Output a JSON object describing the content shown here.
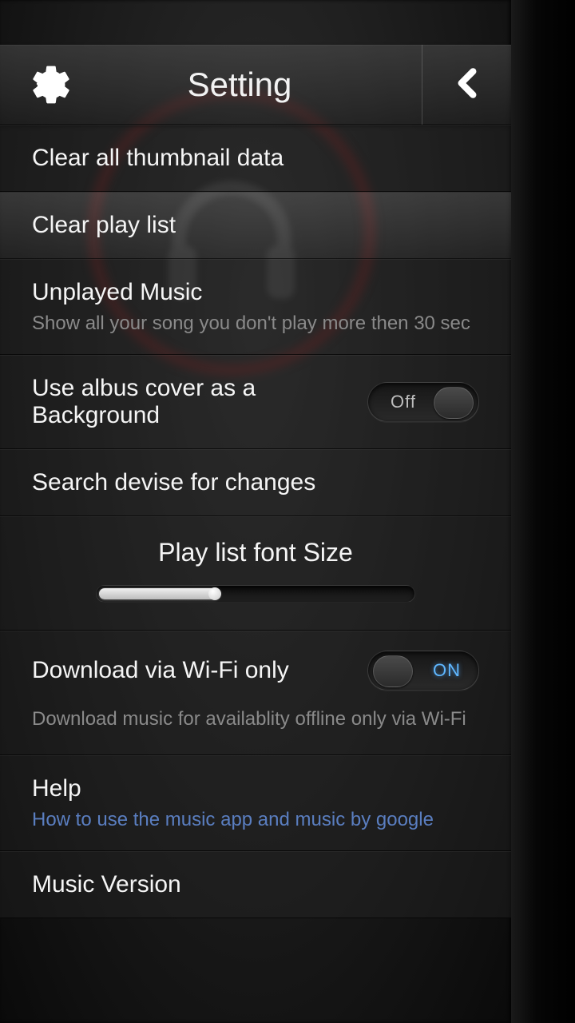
{
  "header": {
    "title": "Setting"
  },
  "rows": {
    "clear_thumb": {
      "label": "Clear all thumbnail data"
    },
    "clear_playlist": {
      "label": "Clear play list"
    },
    "unplayed": {
      "label": "Unplayed Music",
      "sub": "Show all your song you don't play more then 30 sec"
    },
    "album_bg": {
      "label": "Use albus cover as a Background",
      "toggle_state": "Off"
    },
    "search_device": {
      "label": "Search devise for changes"
    },
    "font_size": {
      "label": "Play list font Size",
      "value_pct": 38
    },
    "wifi": {
      "label": "Download via Wi-Fi only",
      "toggle_state": "ON",
      "sub": "Download music for availablity offline only via Wi-Fi"
    },
    "help": {
      "label": "Help",
      "sub": "How to use the music app and music by google"
    },
    "version": {
      "label": "Music Version"
    }
  }
}
